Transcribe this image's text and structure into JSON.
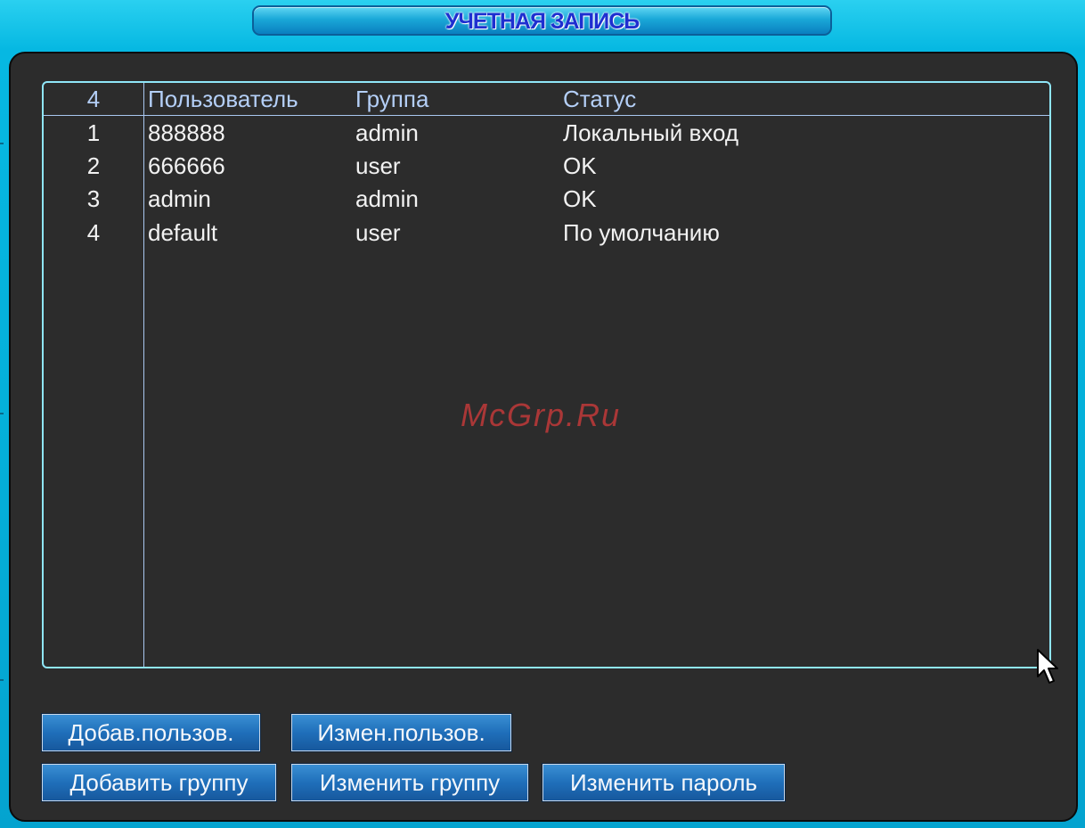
{
  "window": {
    "title": "УЧЕТНАЯ ЗАПИСЬ"
  },
  "table": {
    "headers": {
      "count": "4",
      "user": "Пользователь",
      "group": "Группа",
      "status": "Статус"
    },
    "rows": [
      {
        "num": "1",
        "user": "888888",
        "group": "admin",
        "status": "Локальный вход"
      },
      {
        "num": "2",
        "user": "666666",
        "group": "user",
        "status": "OK"
      },
      {
        "num": "3",
        "user": "admin",
        "group": "admin",
        "status": "OK"
      },
      {
        "num": "4",
        "user": "default",
        "group": "user",
        "status": "По умолчанию"
      }
    ]
  },
  "buttons": {
    "add_user": "Добав.пользов.",
    "edit_user": "Измен.пользов.",
    "add_group": "Добавить группу",
    "edit_group": "Изменить группу",
    "change_password": "Изменить пароль"
  },
  "watermark": "McGrp.Ru",
  "colors": {
    "background": "#04aed8",
    "panel": "#2c2c2c",
    "table_border": "#8fe6f8",
    "header_text": "#b4cff7",
    "title_text": "#1e2fd0",
    "button": "#1f6fba"
  },
  "icons": {
    "cursor": "mouse-pointer-icon"
  }
}
